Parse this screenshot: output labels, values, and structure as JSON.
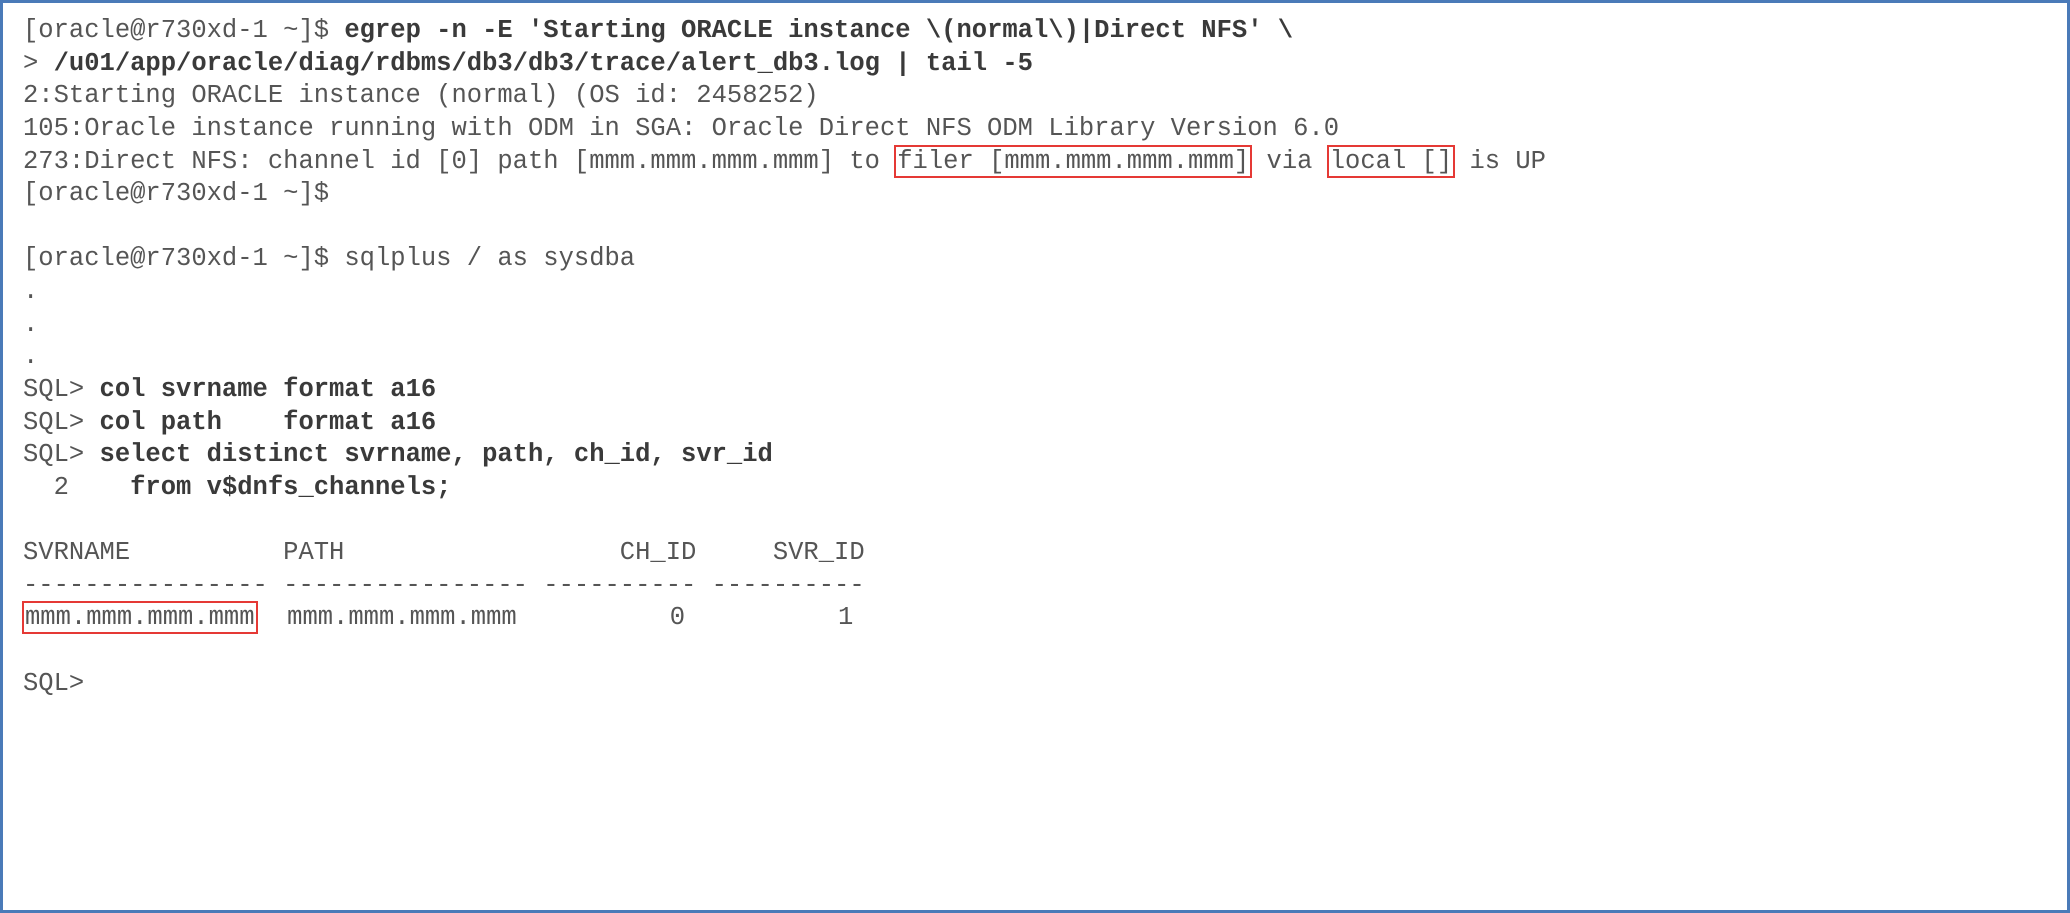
{
  "prompt1": "[oracle@r730xd-1 ~]$ ",
  "cmd1a": "egrep -n -E 'Starting ORACLE instance \\(normal\\)|Direct NFS' \\",
  "cont": "> ",
  "cmd1b": "/u01/app/oracle/diag/rdbms/db3/db3/trace/alert_db3.log | tail -5",
  "out1": "2:Starting ORACLE instance (normal) (OS id: 2458252)",
  "out2": "105:Oracle instance running with ODM in SGA: Oracle Direct NFS ODM Library Version 6.0",
  "out3a": "273:Direct NFS: channel id [0] path [mmm.mmm.mmm.mmm] to ",
  "out3_hl1": "filer [mmm.mmm.mmm.mmm]",
  "out3b": " via ",
  "out3_hl2": "local []",
  "out3c": " is UP",
  "prompt_empty": "[oracle@r730xd-1 ~]$",
  "prompt2": "[oracle@r730xd-1 ~]$ ",
  "cmd2": "sqlplus / as sysdba",
  "dot": ".",
  "sqlp": "SQL> ",
  "sqlcmd1": "col svrname format a16",
  "sqlcmd2": "col path    format a16",
  "sqlcmd3": "select distinct svrname, path, ch_id, svr_id",
  "sqlline2": "  2    ",
  "sqlcmd4": "from v$dnfs_channels;",
  "hdr": "SVRNAME          PATH                  CH_ID     SVR_ID",
  "rule": "---------------- ---------------- ---------- ----------",
  "row_hl": "mmm.mmm.mmm.mmm",
  "row_rest": "  mmm.mmm.mmm.mmm          0          1",
  "sqlprompt_end": "SQL>"
}
